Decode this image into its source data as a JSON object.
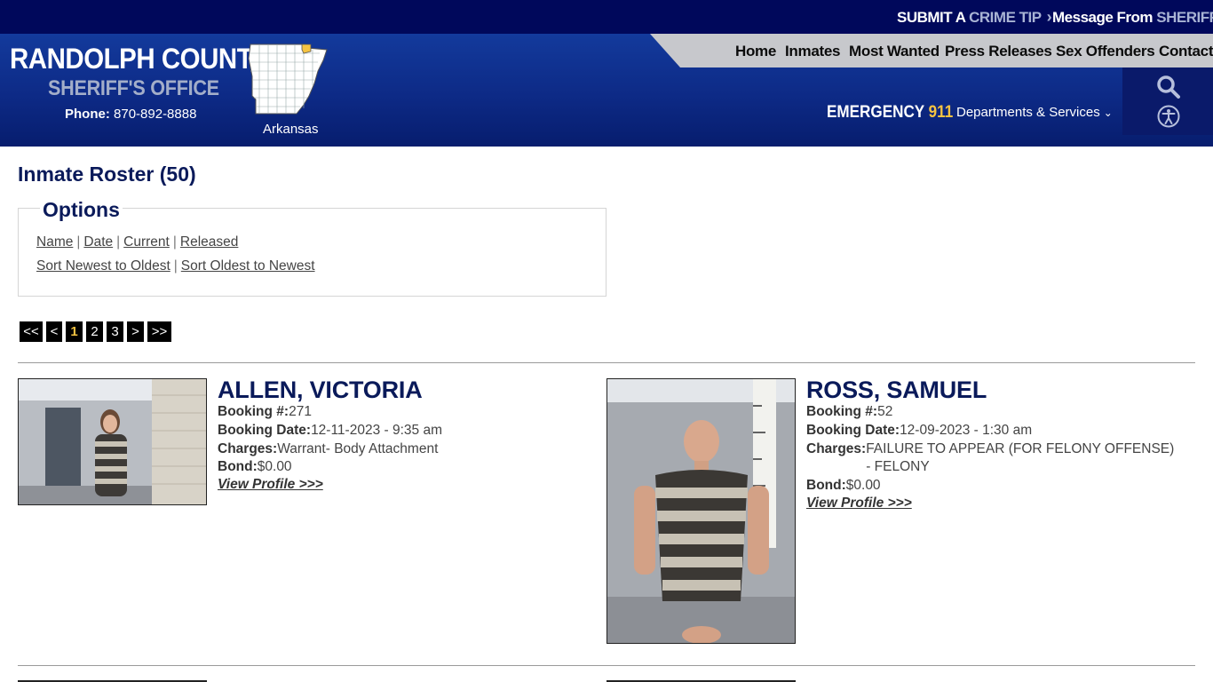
{
  "topbar": {
    "crime_tip": {
      "prefix": "SUBMIT A ",
      "highlight": "CRIME TIP",
      "chevron": "›"
    },
    "message": {
      "prefix": "Message From ",
      "highlight": "SHERIFF",
      "chevron": "›"
    }
  },
  "brand": {
    "title": "RANDOLPH COUNTY",
    "subtitle": "SHERIFF'S OFFICE",
    "phone_label": "Phone:",
    "phone": "870-892-8888",
    "map_label": "Arkansas"
  },
  "nav": {
    "items": [
      "Home",
      "Inmates",
      "Most Wanted",
      "Press Releases",
      "Sex Offenders",
      "Contact"
    ]
  },
  "emergency": {
    "label": "EMERGENCY ",
    "number": "911"
  },
  "departments": {
    "label": "Departments & Services",
    "chevron": "⌄"
  },
  "colors": {
    "navy": "#00085b",
    "header_blue": "#133a9c",
    "accent_yellow": "#f5c342",
    "title_navy": "#0a1a5a"
  },
  "page": {
    "title": "Inmate Roster (50)"
  },
  "options": {
    "legend": "Options",
    "filters": [
      "Name",
      "Date",
      "Current",
      "Released"
    ],
    "sorts": [
      "Sort Newest to Oldest",
      "Sort Oldest to Newest"
    ],
    "separator": "|"
  },
  "pager": {
    "first": "<<",
    "prev": "<",
    "pages": [
      "1",
      "2",
      "3"
    ],
    "next": ">",
    "last": ">>",
    "current": "1"
  },
  "inmates": [
    {
      "name": "ALLEN, VICTORIA",
      "booking_label": "Booking #:",
      "booking": "271",
      "date_label": "Booking Date:",
      "date": "12-11-2023 - 9:35 am",
      "charges_label": "Charges:",
      "charges": "Warrant- Body Attachment",
      "bond_label": "Bond:",
      "bond": "$0.00",
      "link": "View Profile >>>"
    },
    {
      "name": "ROSS, SAMUEL",
      "booking_label": "Booking #:",
      "booking": "52",
      "date_label": "Booking Date:",
      "date": "12-09-2023 - 1:30 am",
      "charges_label": "Charges:",
      "charges": "FAILURE TO APPEAR (FOR FELONY OFFENSE) - FELONY",
      "bond_label": "Bond:",
      "bond": "$0.00",
      "link": "View Profile >>>"
    }
  ]
}
